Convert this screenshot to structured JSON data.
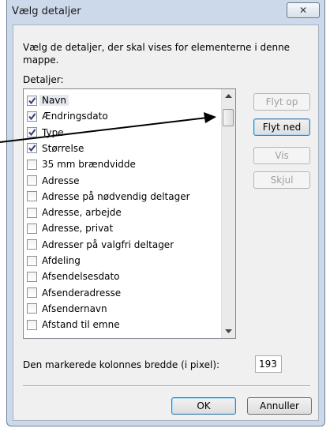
{
  "window": {
    "title": "Vælg detaljer",
    "close_glyph": "✕"
  },
  "dialog": {
    "description": "Vælg de detaljer, der skal  vises for elementerne i denne mappe.",
    "details_label": "Detaljer:",
    "items": [
      {
        "label": "Navn",
        "checked": true
      },
      {
        "label": "Ændringsdato",
        "checked": true
      },
      {
        "label": "Type",
        "checked": true
      },
      {
        "label": "Størrelse",
        "checked": true
      },
      {
        "label": "35 mm brændvidde",
        "checked": false
      },
      {
        "label": "Adresse",
        "checked": false
      },
      {
        "label": "Adresse på nødvendig deltager",
        "checked": false
      },
      {
        "label": "Adresse, arbejde",
        "checked": false
      },
      {
        "label": "Adresse, privat",
        "checked": false
      },
      {
        "label": "Adresser på valgfri deltager",
        "checked": false
      },
      {
        "label": "Afdeling",
        "checked": false
      },
      {
        "label": "Afsendelsesdato",
        "checked": false
      },
      {
        "label": "Afsenderadresse",
        "checked": false
      },
      {
        "label": "Afsendernavn",
        "checked": false
      },
      {
        "label": "Afstand til emne",
        "checked": false
      }
    ],
    "buttons": {
      "move_up": "Flyt op",
      "move_down": "Flyt ned",
      "show": "Vis",
      "hide": "Skjul",
      "ok": "OK",
      "cancel": "Annuller"
    },
    "column_width_label": "Den markerede kolonnes bredde (i pixel):",
    "column_width_value": "193"
  },
  "colors": {
    "frame": "#cbd9ea",
    "client": "#f0f0f0",
    "focus_border": "#3c7fb1",
    "annotation_arrow": "#000000"
  },
  "icons": {
    "close": "close-icon",
    "check": "check-icon",
    "scroll_up": "scroll-up-arrow-icon",
    "scroll_down": "scroll-down-arrow-icon"
  }
}
